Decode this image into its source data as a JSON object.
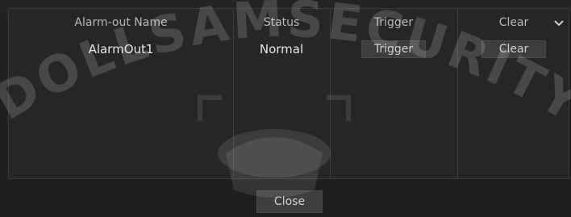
{
  "table": {
    "columns": [
      "Alarm-out Name",
      "Status",
      "Trigger",
      "Clear"
    ],
    "rows": [
      {
        "name": "AlarmOut1",
        "status": "Normal",
        "trigger_label": "Trigger",
        "clear_label": "Clear"
      }
    ]
  },
  "footer": {
    "close_label": "Close"
  },
  "watermark": {
    "text": "DOLLSAMSECURITY"
  },
  "icons": {
    "scroll": "chevron-down-icon"
  }
}
